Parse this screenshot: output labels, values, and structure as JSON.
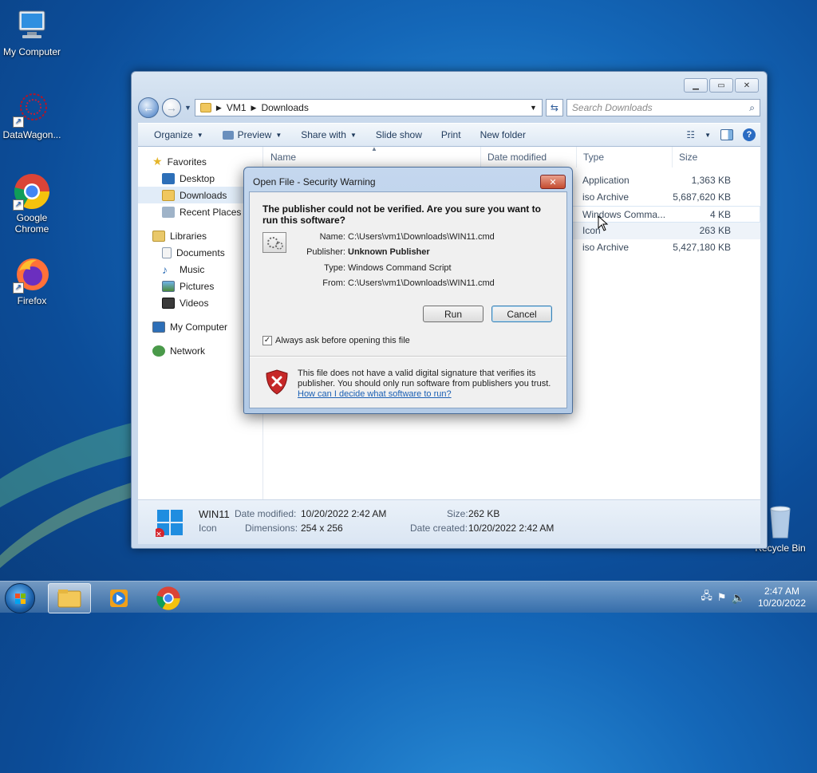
{
  "desktop": {
    "icons": [
      {
        "label": "My Computer"
      },
      {
        "label": "DataWagon..."
      },
      {
        "label": "Google\nChrome"
      },
      {
        "label": "Firefox"
      },
      {
        "label": "Recycle Bin"
      }
    ]
  },
  "explorer": {
    "breadcrumb": [
      "VM1",
      "Downloads"
    ],
    "search_placeholder": "Search Downloads",
    "toolbar": {
      "organize": "Organize",
      "preview": "Preview",
      "share_with": "Share with",
      "slide_show": "Slide show",
      "print": "Print",
      "new_folder": "New folder"
    },
    "nav": {
      "favorites": "Favorites",
      "desktop": "Desktop",
      "downloads": "Downloads",
      "recent_places": "Recent Places",
      "libraries": "Libraries",
      "documents": "Documents",
      "music": "Music",
      "pictures": "Pictures",
      "videos": "Videos",
      "my_computer": "My Computer",
      "network": "Network"
    },
    "columns": {
      "name": "Name",
      "date_modified": "Date modified",
      "type": "Type",
      "size": "Size"
    },
    "files": [
      {
        "type": "Application",
        "size": "1,363 KB"
      },
      {
        "type": "iso Archive",
        "size": "5,687,620 KB"
      },
      {
        "type": "Windows Comma...",
        "size": "4 KB"
      },
      {
        "type": "Icon",
        "size": "263 KB"
      },
      {
        "type": "iso Archive",
        "size": "5,427,180 KB"
      }
    ],
    "details": {
      "name": "WIN11",
      "kind": "Icon",
      "date_modified_label": "Date modified:",
      "date_modified": "10/20/2022 2:42 AM",
      "dimensions_label": "Dimensions:",
      "dimensions": "254 x 256",
      "size_label": "Size:",
      "size": "262 KB",
      "date_created_label": "Date created:",
      "date_created": "10/20/2022 2:42 AM"
    }
  },
  "dialog": {
    "title": "Open File - Security Warning",
    "question": "The publisher could not be verified.  Are you sure you want to run this software?",
    "name_label": "Name:",
    "name": "C:\\Users\\vm1\\Downloads\\WIN11.cmd",
    "publisher_label": "Publisher:",
    "publisher": "Unknown Publisher",
    "type_label": "Type:",
    "type": "Windows Command Script",
    "from_label": "From:",
    "from": "C:\\Users\\vm1\\Downloads\\WIN11.cmd",
    "run": "Run",
    "cancel": "Cancel",
    "always_ask": "Always ask before opening this file",
    "warning": "This file does not have a valid digital signature that verifies its publisher.  You should only run software from publishers you trust.",
    "help_link": "How can I decide what software to run?"
  },
  "taskbar": {
    "time": "2:47 AM",
    "date": "10/20/2022"
  },
  "colors": {
    "accent": "#1a5fb4",
    "close_red": "#c44b2f"
  }
}
